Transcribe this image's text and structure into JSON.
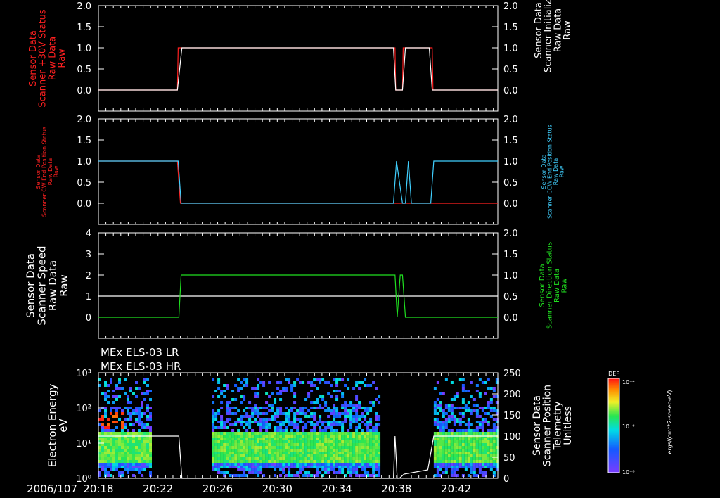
{
  "colors": {
    "background": "#000000",
    "axis": "#ffffff",
    "red": "#ff2020",
    "cyan": "#40d0ff",
    "green": "#20e020",
    "white": "#ffffff"
  },
  "footer": {
    "date_label": "2006/107"
  },
  "colorbar": {
    "title": "DEF",
    "top_label": "10⁻⁴",
    "mid_label": "10⁻⁶",
    "bottom_label": "10⁻⁸",
    "units": "ergs/(cm**2-sr-sec-eV)"
  },
  "chart_data": [
    {
      "type": "line",
      "name": "panel-1",
      "xlim": [
        18.0,
        44.8
      ],
      "ylim_left": [
        -0.5,
        2.0
      ],
      "yticks_left": [
        "2.0",
        "1.5",
        "1.0",
        "0.5",
        "0.0"
      ],
      "yticks_left_values": [
        2.0,
        1.5,
        1.0,
        0.5,
        0.0
      ],
      "ylim_right": [
        -0.5,
        2.0
      ],
      "yticks_right": [
        "2.0",
        "1.5",
        "1.0",
        "0.5",
        "0.0"
      ],
      "yticks_right_values": [
        2.0,
        1.5,
        1.0,
        0.5,
        0.0
      ],
      "ylabel_left": [
        "Sensor Data",
        "Scanner +30V Status",
        "Raw Data",
        "Raw"
      ],
      "ylabel_right": [
        "Sensor Data",
        "Scanner Initialized",
        "Raw Data",
        "Raw"
      ],
      "series": [
        {
          "color": "red",
          "axis": "left",
          "x": [
            18.0,
            23.3,
            23.35,
            37.9,
            37.95,
            38.0,
            38.4,
            38.45,
            40.4,
            40.45,
            44.8
          ],
          "y": [
            0,
            0,
            1,
            1,
            0,
            0,
            0,
            1,
            1,
            0,
            0
          ]
        },
        {
          "color": "white",
          "axis": "right",
          "x": [
            18.0,
            23.3,
            23.6,
            37.8,
            37.95,
            38.4,
            38.6,
            40.2,
            40.4,
            44.8
          ],
          "y": [
            0,
            0,
            1,
            1,
            0,
            0,
            1,
            1,
            0,
            0
          ]
        }
      ]
    },
    {
      "type": "line",
      "name": "panel-2",
      "xlim": [
        18.0,
        44.8
      ],
      "ylim_left": [
        -0.5,
        2.0
      ],
      "yticks_left": [
        "2.0",
        "1.5",
        "1.0",
        "0.5",
        "0.0"
      ],
      "yticks_left_values": [
        2.0,
        1.5,
        1.0,
        0.5,
        0.0
      ],
      "ylim_right": [
        -0.5,
        2.0
      ],
      "yticks_right": [
        "2.0",
        "1.5",
        "1.0",
        "0.5",
        "0.0"
      ],
      "yticks_right_values": [
        2.0,
        1.5,
        1.0,
        0.5,
        0.0
      ],
      "ylabel_left": [
        "Sensor Data",
        "Scanner CW End Position Status",
        "Raw Data",
        "Raw"
      ],
      "ylabel_right": [
        "Sensor Data",
        "Scanner CCW End Position Status",
        "Raw Data",
        "Raw"
      ],
      "series": [
        {
          "color": "red",
          "axis": "left",
          "x": [
            18.0,
            23.3,
            23.5,
            44.8
          ],
          "y": [
            1,
            1,
            0,
            0
          ]
        },
        {
          "color": "cyan",
          "axis": "right",
          "x": [
            18.0,
            23.35,
            23.55,
            37.8,
            38.0,
            38.4,
            38.6,
            38.8,
            39.0,
            40.3,
            40.5,
            44.8
          ],
          "y": [
            1,
            1,
            0,
            0,
            1,
            0,
            0,
            1,
            0,
            0,
            1,
            1
          ]
        }
      ]
    },
    {
      "type": "line",
      "name": "panel-3",
      "xlim": [
        18.0,
        44.8
      ],
      "ylim_left": [
        -1.0,
        4.0
      ],
      "yticks_left": [
        "4",
        "3",
        "2",
        "1",
        "0"
      ],
      "yticks_left_values": [
        4,
        3,
        2,
        1,
        0
      ],
      "ylim_right": [
        -0.5,
        2.0
      ],
      "yticks_right": [
        "2.0",
        "1.5",
        "1.0",
        "0.5",
        "0.0"
      ],
      "yticks_right_values": [
        2.0,
        1.5,
        1.0,
        0.5,
        0.0
      ],
      "ylabel_left": [
        "Sensor Data",
        "Scanner Speed",
        "Raw Data",
        "Raw"
      ],
      "ylabel_right": [
        "Sensor Data",
        "Scanner Direction Status",
        "Raw Data",
        "Raw"
      ],
      "series": [
        {
          "color": "white",
          "axis": "left",
          "x": [
            18.0,
            44.8
          ],
          "y": [
            1,
            1
          ]
        },
        {
          "color": "green",
          "axis": "right",
          "x": [
            18.0,
            23.4,
            23.55,
            37.9,
            38.05,
            38.25,
            38.4,
            38.6,
            44.8
          ],
          "y": [
            0,
            0,
            1,
            1,
            0,
            1,
            1,
            0,
            0
          ]
        }
      ]
    },
    {
      "type": "heatmap",
      "name": "panel-4",
      "titles": [
        "MEx ELS-03 LR",
        "MEx ELS-03 HR"
      ],
      "xlim": [
        18.0,
        44.8
      ],
      "xticks": [
        "20:18",
        "20:22",
        "20:26",
        "20:30",
        "20:34",
        "20:38",
        "20:42"
      ],
      "xticks_values": [
        18,
        22,
        26,
        30,
        34,
        38,
        42
      ],
      "ylim_left_log": [
        1,
        1000
      ],
      "yticks_left": [
        "10³",
        "10²",
        "10¹",
        "10⁰"
      ],
      "yticks_left_values": [
        1000,
        100,
        10,
        1
      ],
      "ylim_right": [
        0,
        250
      ],
      "yticks_right": [
        "250",
        "200",
        "150",
        "100",
        "50",
        "0"
      ],
      "yticks_right_values": [
        250,
        200,
        150,
        100,
        50,
        0
      ],
      "ylabel_left": [
        "Electron Energy",
        "eV"
      ],
      "ylabel_right": [
        "Sensor Data",
        "Scanner Position",
        "Telemetry",
        "Unitless"
      ],
      "data_intervals": [
        [
          18.0,
          21.5
        ],
        [
          25.6,
          36.8
        ],
        [
          40.5,
          44.8
        ]
      ],
      "position_series": {
        "color": "white",
        "x": [
          18.0,
          21.6,
          23.4,
          23.6,
          37.8,
          37.9,
          38.05,
          38.2,
          38.5,
          40.1,
          40.5,
          44.8
        ],
        "y": [
          100,
          100,
          100,
          0,
          0,
          100,
          0,
          0,
          10,
          20,
          100,
          100
        ]
      }
    }
  ]
}
